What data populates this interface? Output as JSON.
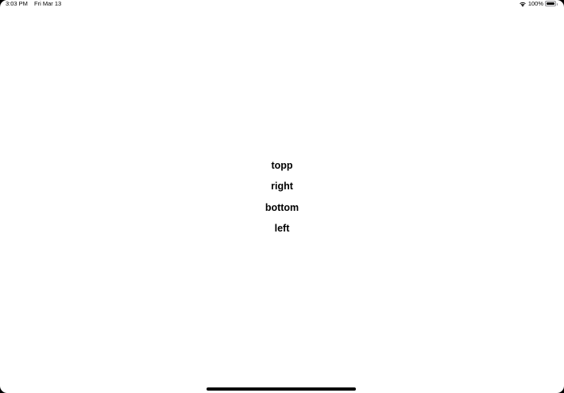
{
  "status_bar": {
    "time": "3:03 PM",
    "date": "Fri Mar 13",
    "battery_percent": "100%",
    "battery_level": 1.0,
    "icons": [
      "wifi-icon",
      "battery-icon"
    ]
  },
  "labels": [
    "topp",
    "right",
    "bottom",
    "left"
  ],
  "colors": {
    "background": "#ffffff",
    "text": "#000000",
    "home_indicator": "#000000"
  }
}
